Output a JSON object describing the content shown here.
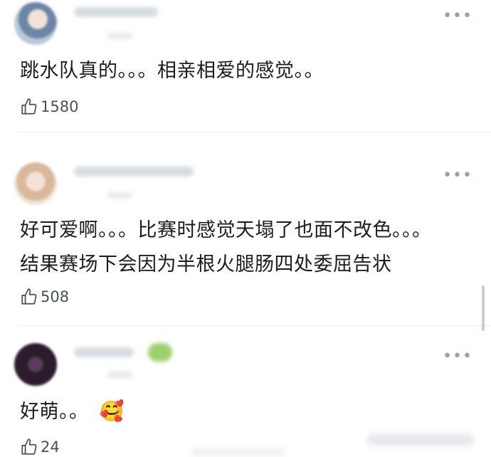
{
  "comments": [
    {
      "text_lines": [
        "跳水队真的。。。相亲相爱的感觉。。"
      ],
      "likes": "1580",
      "avatar_icon": "avatar-blurred-boy",
      "more_icon": "more-dots-icon"
    },
    {
      "text_lines": [
        "好可爱啊。。。比赛时感觉天塌了也面不改色。。。",
        "结果赛场下会因为半根火腿肠四处委屈告状"
      ],
      "likes": "508",
      "avatar_icon": "avatar-blurred-girl",
      "more_icon": "more-dots-icon"
    },
    {
      "text_lines": [
        "好萌。。"
      ],
      "emoji": "🥰",
      "likes": "24",
      "avatar_icon": "avatar-blurred-dark",
      "more_icon": "more-dots-icon"
    }
  ],
  "colors": {
    "text": "#1c1c1c",
    "meta": "#4a4f57",
    "divider": "#eceef1"
  }
}
